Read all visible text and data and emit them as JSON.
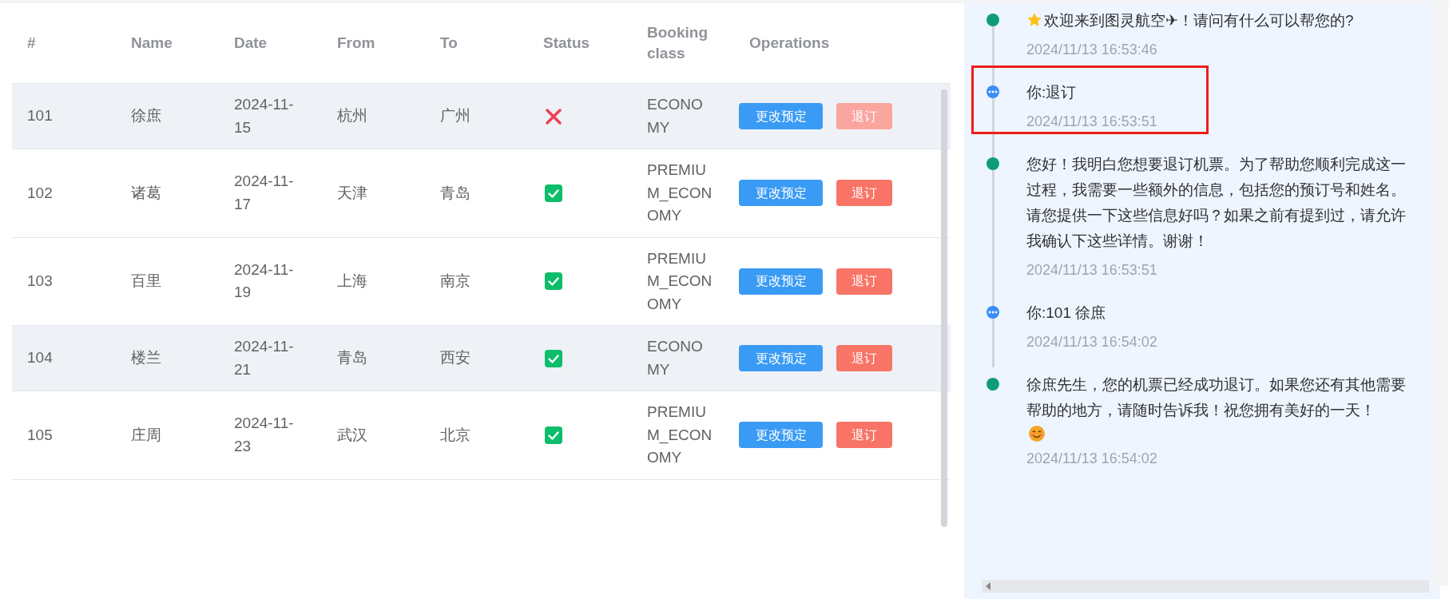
{
  "table": {
    "columns": [
      "#",
      "Name",
      "Date",
      "From",
      "To",
      "Status",
      "Booking class",
      "Operations"
    ],
    "rows": [
      {
        "id": "101",
        "name": "徐庶",
        "date": "2024-11-15",
        "from": "杭州",
        "to": "广州",
        "confirmed": false,
        "booking_class": "ECONOMY",
        "change_button": "更改预定",
        "cancel_button": "退订",
        "cancel_disabled": true,
        "hovered": true
      },
      {
        "id": "102",
        "name": "诸葛",
        "date": "2024-11-17",
        "from": "天津",
        "to": "青岛",
        "confirmed": true,
        "booking_class": "PREMIUM_ECONOMY",
        "change_button": "更改预定",
        "cancel_button": "退订",
        "cancel_disabled": false,
        "hovered": false
      },
      {
        "id": "103",
        "name": "百里",
        "date": "2024-11-19",
        "from": "上海",
        "to": "南京",
        "confirmed": true,
        "booking_class": "PREMIUM_ECONOMY",
        "change_button": "更改预定",
        "cancel_button": "退订",
        "cancel_disabled": false,
        "hovered": false
      },
      {
        "id": "104",
        "name": "楼兰",
        "date": "2024-11-21",
        "from": "青岛",
        "to": "西安",
        "confirmed": true,
        "booking_class": "ECONOMY",
        "change_button": "更改预定",
        "cancel_button": "退订",
        "cancel_disabled": false,
        "hovered": true
      },
      {
        "id": "105",
        "name": "庄周",
        "date": "2024-11-23",
        "from": "武汉",
        "to": "北京",
        "confirmed": true,
        "booking_class": "PREMIUM_ECONOMY",
        "change_button": "更改预定",
        "cancel_button": "退订",
        "cancel_disabled": false,
        "hovered": false
      }
    ]
  },
  "chat": {
    "messages": [
      {
        "kind": "bot",
        "star": true,
        "smiley": false,
        "text": "欢迎来到图灵航空✈！请问有什么可以帮您的?",
        "time": "2024/11/13 16:53:46",
        "highlighted": false
      },
      {
        "kind": "user",
        "star": false,
        "smiley": false,
        "text": "你:退订",
        "time": "2024/11/13 16:53:51",
        "highlighted": true
      },
      {
        "kind": "bot",
        "star": false,
        "smiley": false,
        "text": "您好！我明白您想要退订机票。为了帮助您顺利完成这一过程，我需要一些额外的信息，包括您的预订号和姓名。请您提供一下这些信息好吗？如果之前有提到过，请允许我确认下这些详情。谢谢！",
        "time": "2024/11/13 16:53:51",
        "highlighted": false
      },
      {
        "kind": "user",
        "star": false,
        "smiley": false,
        "text": "你:101 徐庶",
        "time": "2024/11/13 16:54:02",
        "highlighted": false
      },
      {
        "kind": "bot",
        "star": false,
        "smiley": true,
        "text": "徐庶先生，您的机票已经成功退订。如果您还有其他需要帮助的地方，请随时告诉我！祝您拥有美好的一天！",
        "time": "2024/11/13 16:54:02",
        "highlighted": false
      }
    ]
  }
}
